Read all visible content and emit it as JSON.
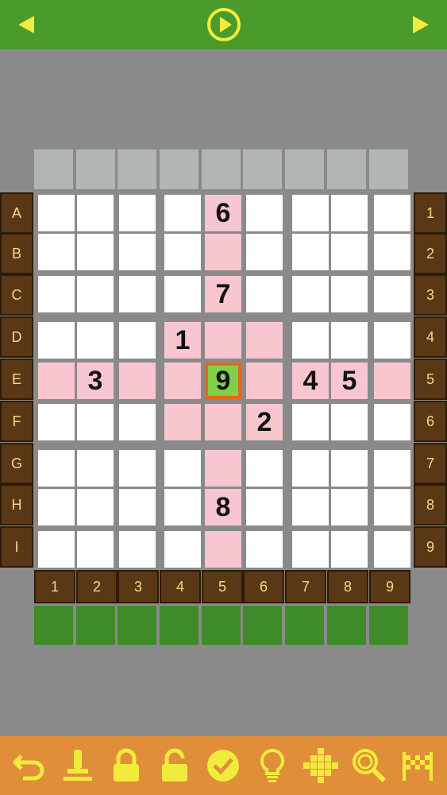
{
  "toolbar": {
    "prev_icon": "arrow-left-icon",
    "play_icon": "play-circle-icon",
    "next_icon": "arrow-right-icon"
  },
  "row_labels": [
    "A",
    "B",
    "C",
    "D",
    "E",
    "F",
    "G",
    "H",
    "I"
  ],
  "row_numbers": [
    "1",
    "2",
    "3",
    "4",
    "5",
    "6",
    "7",
    "8",
    "9"
  ],
  "col_labels": [
    "1",
    "2",
    "3",
    "4",
    "5",
    "6",
    "7",
    "8",
    "9"
  ],
  "grid": [
    [
      "",
      "",
      "",
      "",
      "6",
      "",
      "",
      "",
      ""
    ],
    [
      "",
      "",
      "",
      "",
      "",
      "",
      "",
      "",
      ""
    ],
    [
      "",
      "",
      "",
      "",
      "7",
      "",
      "",
      "",
      ""
    ],
    [
      "",
      "",
      "",
      "1",
      "",
      "",
      "",
      "",
      ""
    ],
    [
      "",
      "3",
      "",
      "",
      "9",
      "",
      "4",
      "5",
      ""
    ],
    [
      "",
      "",
      "",
      "",
      "",
      "2",
      "",
      "",
      ""
    ],
    [
      "",
      "",
      "",
      "",
      "",
      "",
      "",
      "",
      ""
    ],
    [
      "",
      "",
      "",
      "",
      "8",
      "",
      "",
      "",
      ""
    ],
    [
      "",
      "",
      "",
      "",
      "",
      "",
      "",
      "",
      ""
    ]
  ],
  "selected": {
    "row": 4,
    "col": 4
  },
  "colors": {
    "top_bar": "#4a9b2c",
    "icon_yellow": "#f1ec3c",
    "highlight": "#f7c6cf",
    "selected_fill": "#7dd24a",
    "selected_border": "#e2691f",
    "label_bg": "#5a3815",
    "bottom_bar": "#e08e3a"
  },
  "bottom_tools": [
    "undo-icon",
    "stamp-icon",
    "lock-icon",
    "unlock-icon",
    "check-circle-icon",
    "lightbulb-icon",
    "cross-pattern-icon",
    "magnifier-icon",
    "finish-flag-icon"
  ]
}
